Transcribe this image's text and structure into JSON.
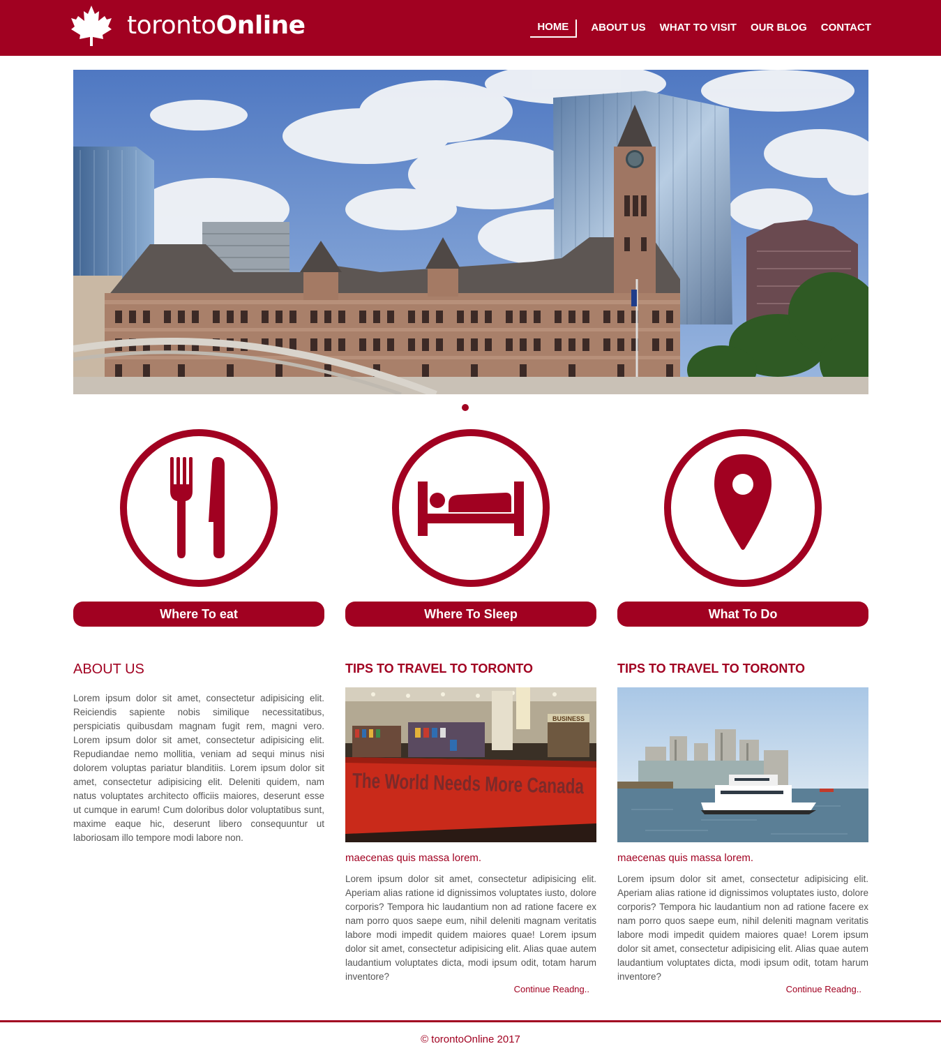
{
  "brand": {
    "prefix": "toronto",
    "suffix": "Online",
    "accent": "#a10121"
  },
  "nav": [
    {
      "label": "HOME",
      "active": true
    },
    {
      "label": "ABOUT US"
    },
    {
      "label": "WHAT TO VISIT"
    },
    {
      "label": "OUR BLOG"
    },
    {
      "label": "CONTACT"
    }
  ],
  "features": [
    {
      "icon": "fork-knife-icon",
      "label": "Where To eat"
    },
    {
      "icon": "bed-icon",
      "label": "Where To Sleep"
    },
    {
      "icon": "map-pin-icon",
      "label": "What To Do"
    }
  ],
  "about": {
    "title": "ABOUT US",
    "text": "Lorem ipsum dolor sit amet, consectetur adipisicing elit. Reiciendis sapiente nobis similique necessitatibus, perspiciatis quibusdam magnam fugit rem, magni vero. Lorem ipsum dolor sit amet, consectetur adipisicing elit. Repudiandae nemo mollitia, veniam ad sequi minus nisi dolorem voluptas pariatur blanditiis. Lorem ipsum dolor sit amet, consectetur adipisicing elit. Deleniti quidem, nam natus voluptates architecto officiis maiores, deserunt esse ut cumque in earum! Cum doloribus dolor voluptatibus sunt, maxime eaque hic, deserunt libero consequuntur ut laboriosam illo tempore modi labore non."
  },
  "posts": [
    {
      "title": "TIPS TO TRAVEL TO TORONTO",
      "sign_text": "The World Needs More Canada",
      "sign_small": "BUSINESS",
      "subtitle": "maecenas quis massa lorem.",
      "text": "Lorem ipsum dolor sit amet, consectetur adipisicing elit. Aperiam alias ratione id dignissimos voluptates iusto, dolore corporis? Tempora hic laudantium non ad ratione facere ex nam porro quos saepe eum, nihil deleniti magnam veritatis labore modi impedit quidem maiores quae! Lorem ipsum dolor sit amet, consectetur adipisicing elit. Alias quae autem laudantium voluptates dicta, modi ipsum odit, totam harum inventore?",
      "more": "Continue Readng.."
    },
    {
      "title": "TIPS TO TRAVEL TO TORONTO",
      "subtitle": "maecenas quis massa lorem.",
      "text": "Lorem ipsum dolor sit amet, consectetur adipisicing elit. Aperiam alias ratione id dignissimos voluptates iusto, dolore corporis? Tempora hic laudantium non ad ratione facere ex nam porro quos saepe eum, nihil deleniti magnam veritatis labore modi impedit quidem maiores quae! Lorem ipsum dolor sit amet, consectetur adipisicing elit. Alias quae autem laudantium voluptates dicta, modi ipsum odit, totam harum inventore?",
      "more": "Continue Readng.."
    }
  ],
  "footer": {
    "text": "© torontoOnline 2017"
  }
}
